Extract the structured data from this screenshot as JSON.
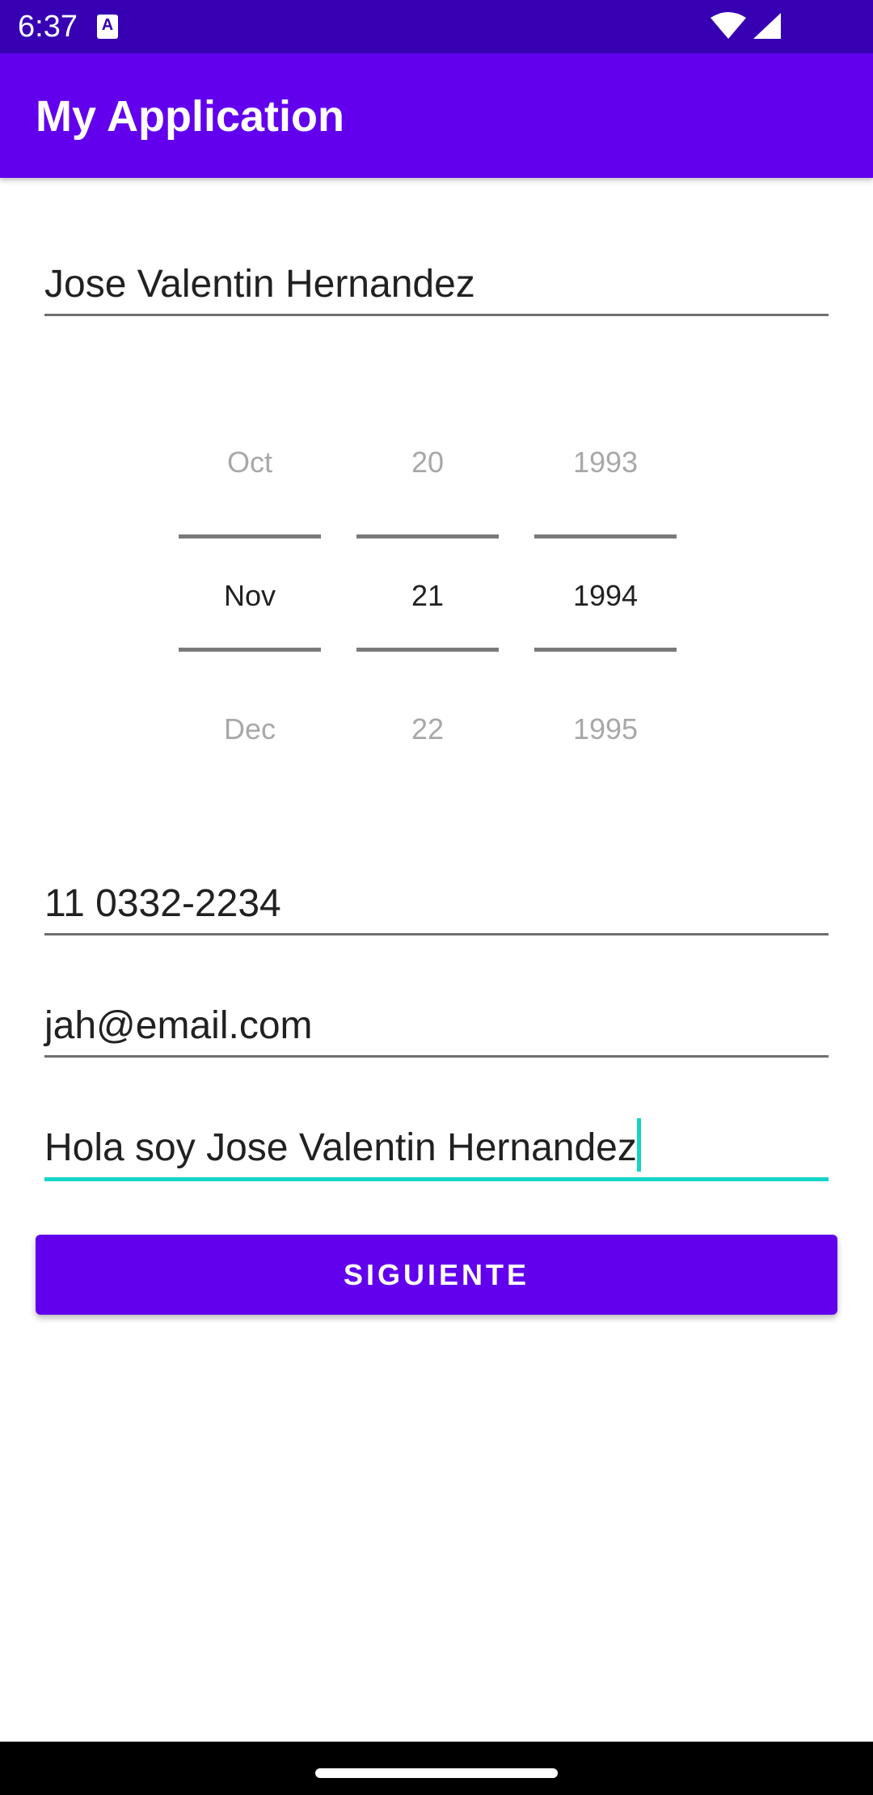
{
  "status_bar": {
    "time": "6:37",
    "notification_icon": "text-input-a-icon",
    "notification_glyph": "A",
    "icons": [
      "wifi-icon",
      "cell-signal-icon"
    ]
  },
  "app_bar": {
    "title": "My Application"
  },
  "form": {
    "name_value": "Jose Valentin Hernandez",
    "date_picker": {
      "month": {
        "prev": "Oct",
        "selected": "Nov",
        "next": "Dec"
      },
      "day": {
        "prev": "20",
        "selected": "21",
        "next": "22"
      },
      "year": {
        "prev": "1993",
        "selected": "1994",
        "next": "1995"
      }
    },
    "phone_value": "11 0332-2234",
    "email_value": "jah@email.com",
    "description_value": "Hola soy Jose Valentin Hernandez",
    "next_button_label": "SIGUIENTE"
  },
  "colors": {
    "status_bar": "#3700b3",
    "primary": "#6200ee",
    "accent_focus": "#14d4c6",
    "text": "#212121",
    "dim_text": "#a8a8a8"
  },
  "nav_bar": {
    "handle": "home-gesture-handle"
  }
}
